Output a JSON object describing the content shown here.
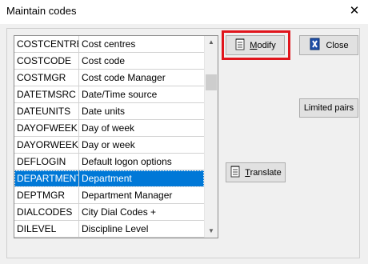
{
  "window": {
    "title": "Maintain codes",
    "close_glyph": "✕"
  },
  "list": {
    "rows": [
      {
        "code": "COSTCENTRE",
        "desc": "Cost centres",
        "selected": false
      },
      {
        "code": "COSTCODE",
        "desc": "Cost code",
        "selected": false
      },
      {
        "code": "COSTMGR",
        "desc": "Cost code Manager",
        "selected": false
      },
      {
        "code": "DATETMSRC",
        "desc": "Date/Time source",
        "selected": false
      },
      {
        "code": "DATEUNITS",
        "desc": "Date units",
        "selected": false
      },
      {
        "code": "DAYOFWEEK",
        "desc": "Day of week",
        "selected": false
      },
      {
        "code": "DAYORWEEK",
        "desc": "Day or week",
        "selected": false
      },
      {
        "code": "DEFLOGIN",
        "desc": "Default logon options",
        "selected": false
      },
      {
        "code": "DEPARTMENT",
        "desc": "Department",
        "selected": true
      },
      {
        "code": "DEPTMGR",
        "desc": "Department Manager",
        "selected": false
      },
      {
        "code": "DIALCODES",
        "desc": "City Dial Codes +",
        "selected": false
      },
      {
        "code": "DILEVEL",
        "desc": "Discipline Level",
        "selected": false
      }
    ]
  },
  "buttons": {
    "modify": {
      "label_accel": "M",
      "label_rest": "odify",
      "icon": "notepad-icon"
    },
    "close": {
      "label": "Close",
      "icon": "close-door-icon"
    },
    "translate": {
      "label_accel": "T",
      "label_rest": "ranslate",
      "icon": "notepad-icon"
    },
    "limited_pairs": {
      "label": "Limited pairs"
    }
  },
  "colors": {
    "selection": "#0078d7",
    "highlight_frame": "#e0151c"
  }
}
